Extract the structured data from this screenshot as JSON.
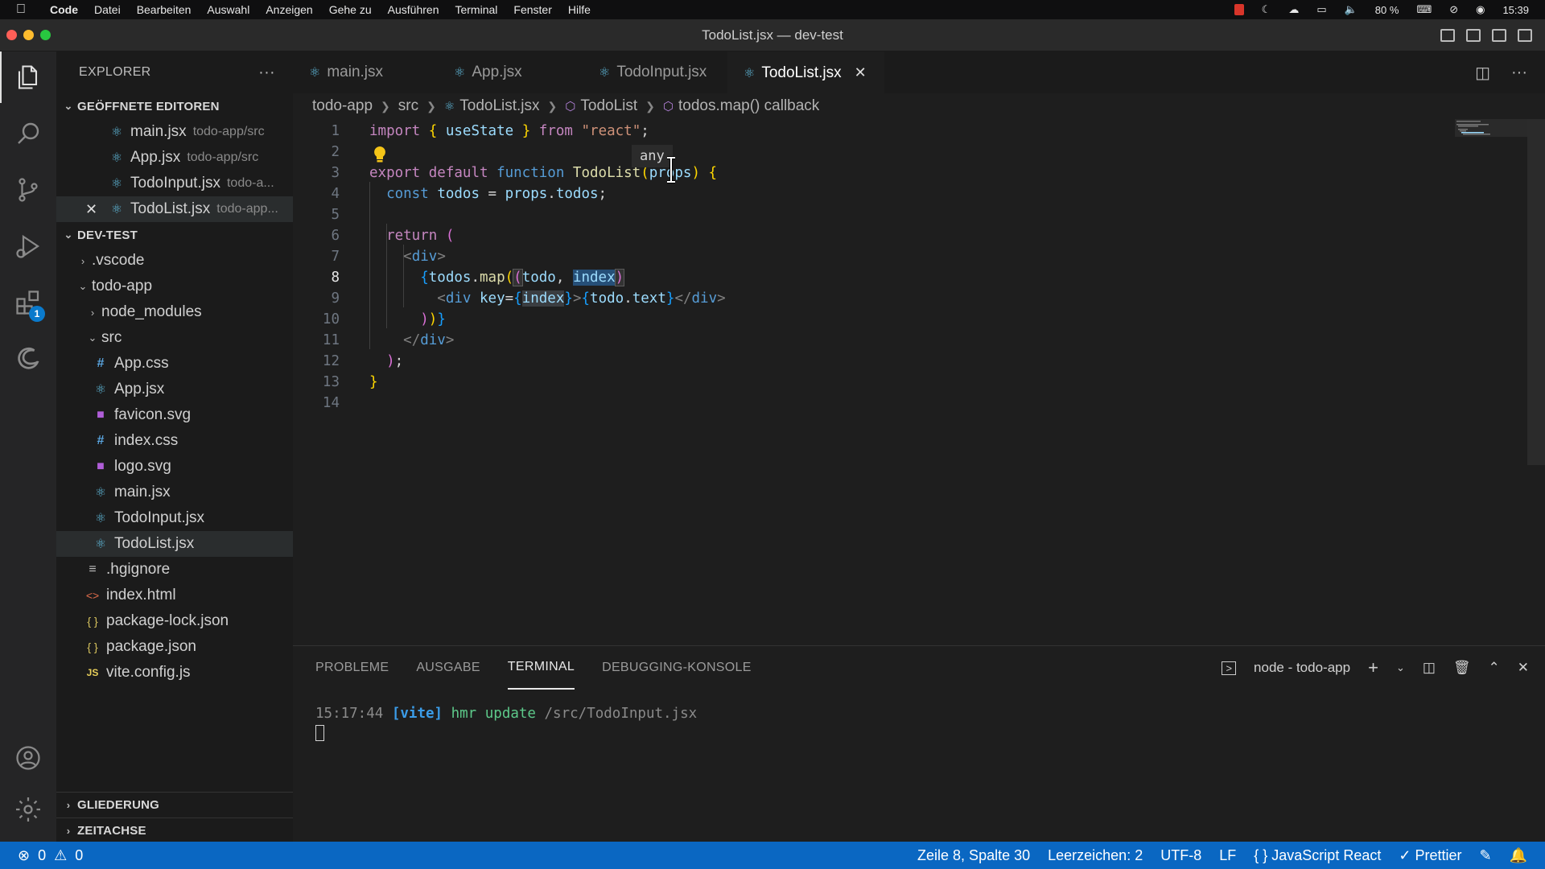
{
  "menubar": {
    "app": "Code",
    "items": [
      "Datei",
      "Bearbeiten",
      "Auswahl",
      "Anzeigen",
      "Gehe zu",
      "Ausführen",
      "Terminal",
      "Fenster",
      "Hilfe"
    ],
    "battery": "80 %",
    "clock": "15:39"
  },
  "window": {
    "title": "TodoList.jsx — dev-test"
  },
  "activity": {
    "extensions_badge": "1"
  },
  "explorer": {
    "title": "EXPLORER",
    "open_editors_title": "GEÖFFNETE EDITOREN",
    "open_editors": [
      {
        "name": "main.jsx",
        "path": "todo-app/src"
      },
      {
        "name": "App.jsx",
        "path": "todo-app/src"
      },
      {
        "name": "TodoInput.jsx",
        "path": "todo-a..."
      },
      {
        "name": "TodoList.jsx",
        "path": "todo-app..."
      }
    ],
    "workspace_title": "DEV-TEST",
    "tree": {
      "vscode": ".vscode",
      "todo_app": "todo-app",
      "node_modules": "node_modules",
      "src": "src",
      "src_files": [
        "App.css",
        "App.jsx",
        "favicon.svg",
        "index.css",
        "logo.svg",
        "main.jsx",
        "TodoInput.jsx",
        "TodoList.jsx"
      ],
      "root_files": [
        ".hgignore",
        "index.html",
        "package-lock.json",
        "package.json",
        "vite.config.js"
      ]
    },
    "outline_title": "GLIEDERUNG",
    "timeline_title": "ZEITACHSE"
  },
  "tabs": [
    "main.jsx",
    "App.jsx",
    "TodoInput.jsx",
    "TodoList.jsx"
  ],
  "breadcrumb": [
    "todo-app",
    "src",
    "TodoList.jsx",
    "TodoList",
    "todos.map() callback"
  ],
  "code": {
    "line_numbers": [
      "1",
      "2",
      "3",
      "4",
      "5",
      "6",
      "7",
      "8",
      "9",
      "10",
      "11",
      "12",
      "13",
      "14"
    ],
    "hint": "any"
  },
  "panel": {
    "tabs": [
      "PROBLEME",
      "AUSGABE",
      "TERMINAL",
      "DEBUGGING-KONSOLE"
    ],
    "terminal_name": "node - todo-app",
    "log_time": "15:17:44",
    "log_tag": "[vite]",
    "log_msg": "hmr update",
    "log_path": "/src/TodoInput.jsx"
  },
  "statusbar": {
    "errors": "0",
    "warnings": "0",
    "position": "Zeile 8, Spalte 30",
    "spaces": "Leerzeichen: 2",
    "encoding": "UTF-8",
    "eol": "LF",
    "language": "JavaScript React",
    "formatter": "Prettier"
  },
  "colors": {
    "accent": "#0a67c2",
    "background": "#1e1e1e"
  }
}
